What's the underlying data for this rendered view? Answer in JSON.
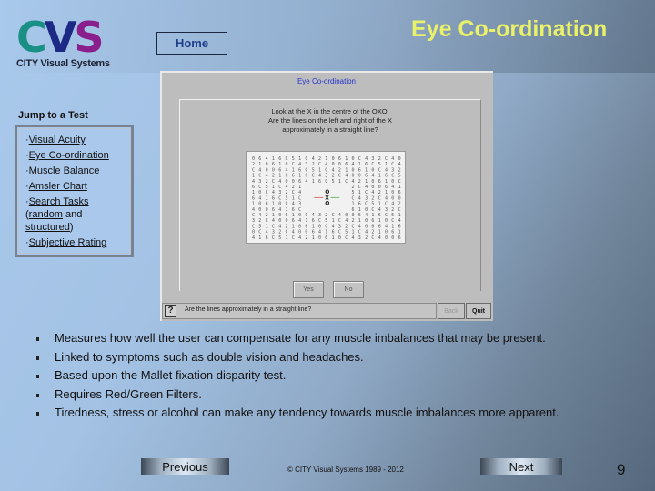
{
  "logo": {
    "letters": [
      "C",
      "V",
      "S"
    ],
    "subtitle": "CITY Visual Systems",
    "colors": {
      "c": "#1a8f86",
      "v": "#1c2a86",
      "s": "#8a1e8c"
    }
  },
  "header": {
    "home_label": "Home",
    "title": "Eye Co-ordination",
    "title_color": "#e9f06a"
  },
  "jump": {
    "title": "Jump to a Test",
    "items": [
      {
        "prefix": "·",
        "label": "Visual Acuity"
      },
      {
        "prefix": "·",
        "label": "Eye Co-ordination"
      },
      {
        "prefix": "·",
        "label": "Muscle Balance"
      },
      {
        "prefix": "·",
        "label": "Amsler Chart"
      },
      {
        "prefix": "·",
        "label": "Search Tasks",
        "sub_open": "(",
        "sub_link1": "random",
        "sub_mid": " and ",
        "sub_link2": "structured",
        "sub_close": ")"
      },
      {
        "prefix": "·",
        "label": "Subjective Rating"
      }
    ]
  },
  "screenshot": {
    "link": "Eye Co-ordination",
    "instructions": [
      "Look at the X in the centre of the OXO.",
      "Are the lines on the left and right of the X",
      "approximately in a straight line?"
    ],
    "grid_glyphs": "0CC64442311260CC6451010",
    "center_glyphs": {
      "top": "O",
      "middle": "X",
      "bottom": "O"
    },
    "line_colors": {
      "left": "#e07070",
      "right": "#70c070"
    },
    "yes_label": "Yes",
    "no_label": "No",
    "help_glyph": "?",
    "status_text": "Are the lines approximately in a straight line?",
    "back_label": "Back",
    "quit_label": "Quit"
  },
  "bullets": [
    "Measures how well the user can compensate for any muscle imbalances that may be present.",
    "Linked to symptoms such as double vision and headaches.",
    "Based upon the Mallet fixation disparity test.",
    "Requires Red/Green Filters.",
    "Tiredness, stress or alcohol can make any tendency towards muscle imbalances more apparent."
  ],
  "footer": {
    "previous_label": "Previous",
    "next_label": "Next",
    "copyright": "© CITY Visual Systems 1989 - 2012",
    "page_number": "9"
  }
}
